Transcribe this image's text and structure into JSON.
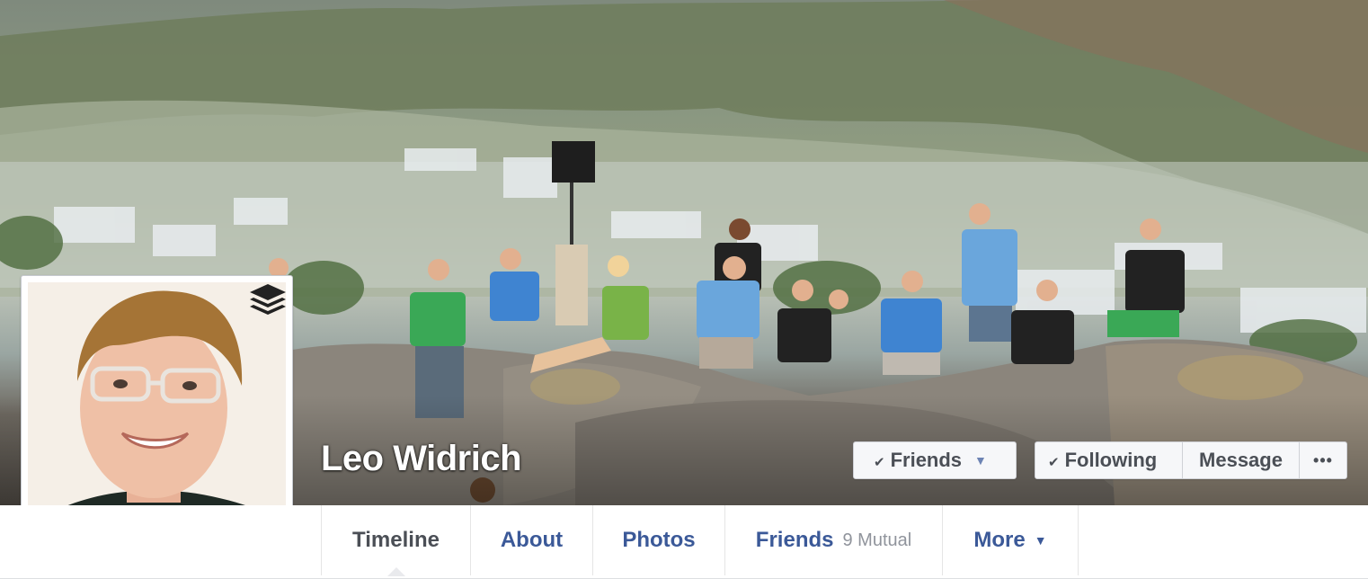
{
  "profile": {
    "name": "Leo Widrich"
  },
  "actions": {
    "friends_label": "Friends",
    "following_label": "Following",
    "message_label": "Message",
    "more_label": "•••"
  },
  "tabs": [
    {
      "label": "Timeline",
      "active": true
    },
    {
      "label": "About"
    },
    {
      "label": "Photos"
    },
    {
      "label": "Friends",
      "sub": "9 Mutual"
    },
    {
      "label": "More"
    }
  ],
  "icons": {
    "check": "checkmark-icon",
    "caret": "caret-down-icon",
    "badge": "buffer-logo-icon"
  },
  "colors": {
    "link": "#3b5998",
    "button_bg": "#f6f7f9",
    "text_dark": "#4b4f56"
  }
}
